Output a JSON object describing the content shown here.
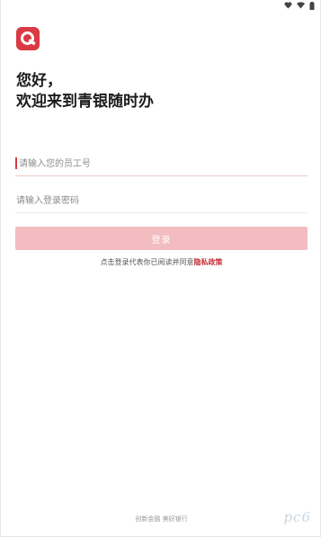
{
  "status_bar": {
    "icons": [
      "heart-icon",
      "wifi-icon",
      "battery-icon"
    ]
  },
  "app": {
    "logo_icon": "app-logo-q-icon",
    "brand_color": "#d93a43"
  },
  "greeting": {
    "line1": "您好，",
    "line2": "欢迎来到青银随时办"
  },
  "form": {
    "employee_id": {
      "placeholder": "请输入您的员工号",
      "value": ""
    },
    "password": {
      "placeholder": "请输入登录密码",
      "value": ""
    },
    "login_label": "登录",
    "login_color": "#f2bcc0"
  },
  "agreement": {
    "prefix": "点击登录代表你已阅读并同意",
    "policy_link": "隐私政策",
    "link_color": "#c62f38"
  },
  "footer": {
    "slogan": "创新金融 美好银行",
    "watermark": "pc6"
  }
}
